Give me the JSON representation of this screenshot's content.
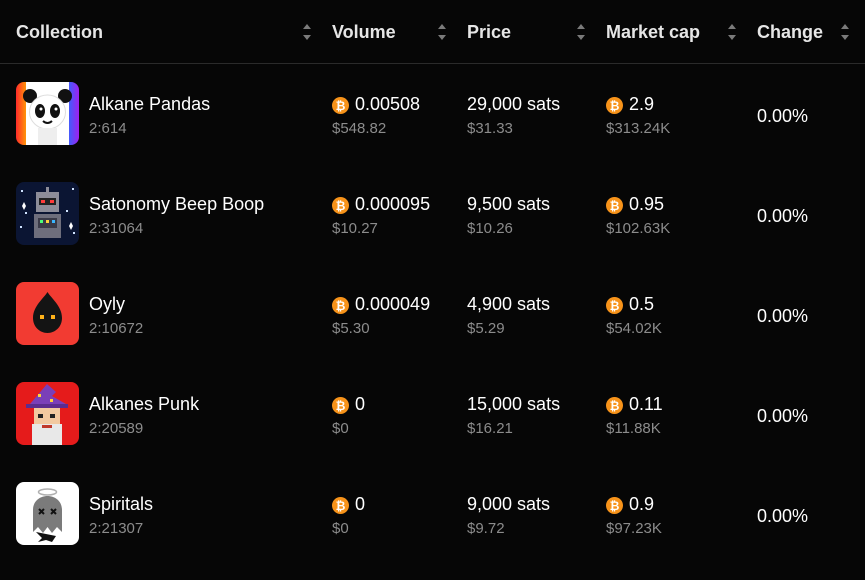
{
  "header": {
    "collection": "Collection",
    "volume": "Volume",
    "price": "Price",
    "market_cap": "Market cap",
    "change": "Change"
  },
  "icons": {
    "sort": "sort-updown-icon",
    "currency": "bitcoin-icon",
    "currency_glyph": "₿"
  },
  "colors": {
    "background": "#060606",
    "text": "#ffffff",
    "muted": "#8c8c8c",
    "bitcoin": "#f7931a",
    "divider": "#2a2a2a"
  },
  "rows": [
    {
      "name": "Alkane Pandas",
      "id": "2:614",
      "volume_btc": "0.00508",
      "volume_usd": "$548.82",
      "price_sats": "29,000 sats",
      "price_usd": "$31.33",
      "mcap_btc": "2.9",
      "mcap_usd": "$313.24K",
      "change": "0.00%"
    },
    {
      "name": "Satonomy Beep Boop",
      "id": "2:31064",
      "volume_btc": "0.000095",
      "volume_usd": "$10.27",
      "price_sats": "9,500 sats",
      "price_usd": "$10.26",
      "mcap_btc": "0.95",
      "mcap_usd": "$102.63K",
      "change": "0.00%"
    },
    {
      "name": "Oyly",
      "id": "2:10672",
      "volume_btc": "0.000049",
      "volume_usd": "$5.30",
      "price_sats": "4,900 sats",
      "price_usd": "$5.29",
      "mcap_btc": "0.5",
      "mcap_usd": "$54.02K",
      "change": "0.00%"
    },
    {
      "name": "Alkanes Punk",
      "id": "2:20589",
      "volume_btc": "0",
      "volume_usd": "$0",
      "price_sats": "15,000 sats",
      "price_usd": "$16.21",
      "mcap_btc": "0.11",
      "mcap_usd": "$11.88K",
      "change": "0.00%"
    },
    {
      "name": "Spiritals",
      "id": "2:21307",
      "volume_btc": "0",
      "volume_usd": "$0",
      "price_sats": "9,000 sats",
      "price_usd": "$9.72",
      "mcap_btc": "0.9",
      "mcap_usd": "$97.23K",
      "change": "0.00%"
    }
  ]
}
